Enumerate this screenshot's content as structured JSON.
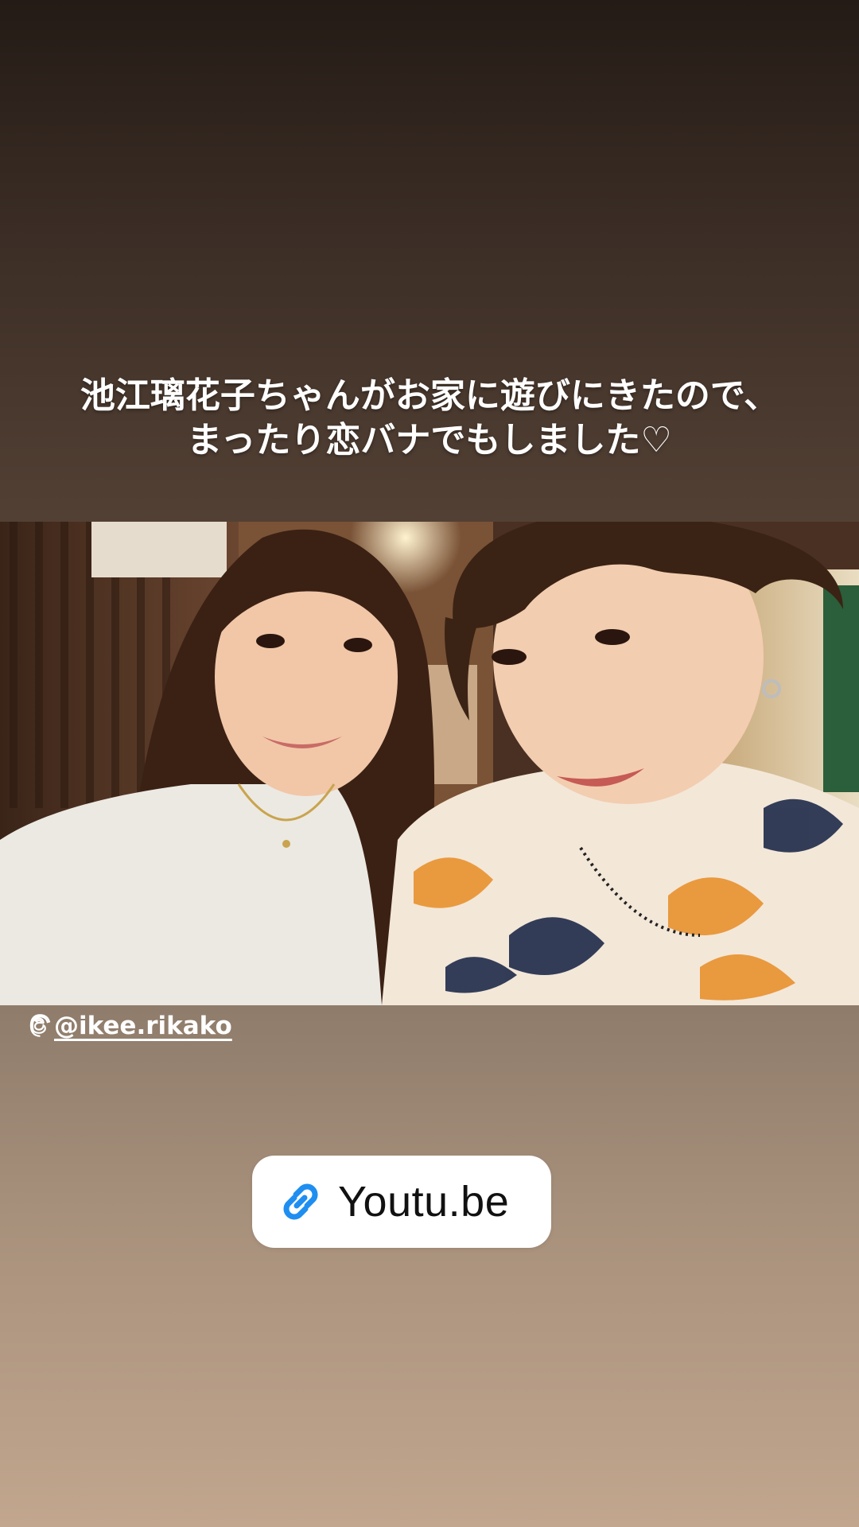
{
  "story": {
    "caption_line1": "池江璃花子ちゃんがお家に遊びにきたので、",
    "caption_line2": "まったり恋バナでもしました♡",
    "mention": "@ikee.rikako",
    "link_label": "Youtu.be"
  },
  "icons": {
    "mention_icon": "threads-icon",
    "link_icon": "link-icon"
  },
  "colors": {
    "link_icon_blue": "#1f8ef1",
    "caption_text": "#ffffff"
  }
}
